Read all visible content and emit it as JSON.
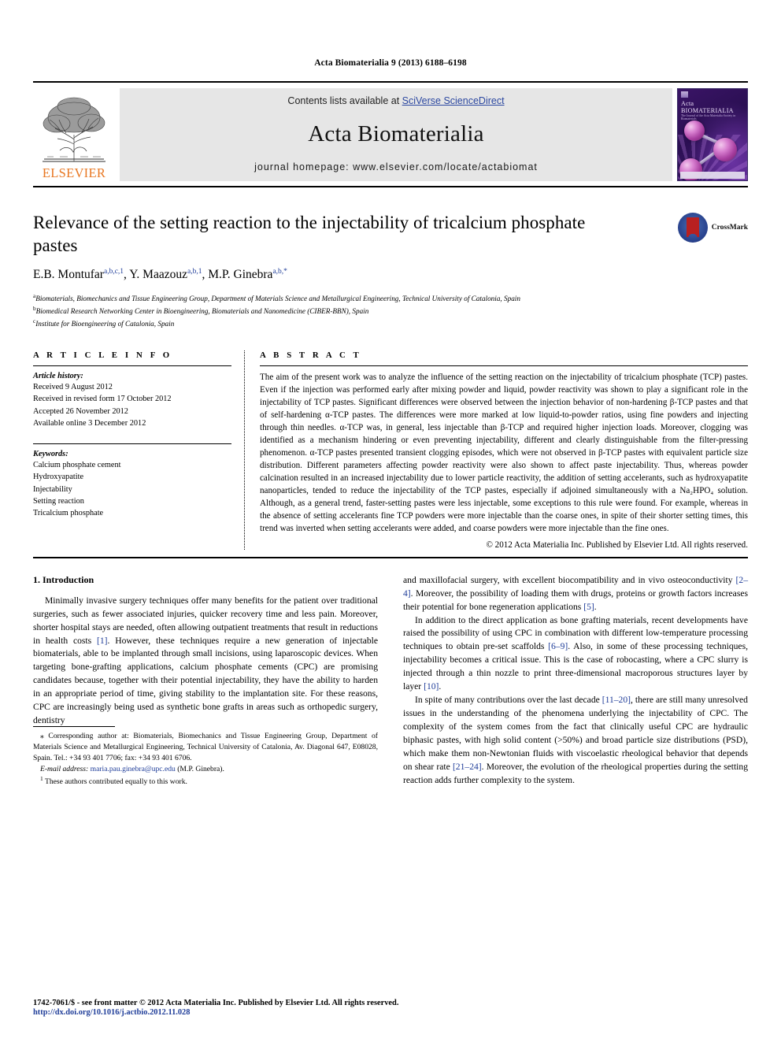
{
  "running_head": "Acta Biomaterialia 9 (2013) 6188–6198",
  "banner": {
    "publisher_logo_name": "ELSEVIER",
    "contents_prefix": "Contents lists available at ",
    "contents_link": "SciVerse ScienceDirect",
    "journal_name": "Acta Biomaterialia",
    "homepage_line": "journal homepage: www.elsevier.com/locate/actabiomat",
    "cover_title": "Acta BIOMATERIALIA",
    "cover_subtitle": "The Journal of the Acta Materialia Society in Biomaterials"
  },
  "article": {
    "title": "Relevance of the setting reaction to the injectability of tricalcium phosphate pastes",
    "crossmark_label": "CrossMark",
    "authors": [
      {
        "name": "E.B. Montufar",
        "sup": "a,b,c,1",
        "sep": ", "
      },
      {
        "name": "Y. Maazouz",
        "sup": "a,b,1",
        "sep": ", "
      },
      {
        "name": "M.P. Ginebra",
        "sup": "a,b,*",
        "sep": ""
      }
    ],
    "affiliations": [
      {
        "mark": "a",
        "text": "Biomaterials, Biomechanics and Tissue Engineering Group, Department of Materials Science and Metallurgical Engineering, Technical University of Catalonia, Spain"
      },
      {
        "mark": "b",
        "text": "Biomedical Research Networking Center in Bioengineering, Biomaterials and Nanomedicine (CIBER-BBN), Spain"
      },
      {
        "mark": "c",
        "text": "Institute for Bioengineering of Catalonia, Spain"
      }
    ]
  },
  "article_info": {
    "heading": "A R T I C L E    I N F O",
    "history_label": "Article history:",
    "history": [
      "Received 9 August 2012",
      "Received in revised form 17 October 2012",
      "Accepted 26 November 2012",
      "Available online 3 December 2012"
    ],
    "keywords_label": "Keywords:",
    "keywords": [
      "Calcium phosphate cement",
      "Hydroxyapatite",
      "Injectability",
      "Setting reaction",
      "Tricalcium phosphate"
    ]
  },
  "abstract": {
    "heading": "A B S T R A C T",
    "text": "The aim of the present work was to analyze the influence of the setting reaction on the injectability of tricalcium phosphate (TCP) pastes. Even if the injection was performed early after mixing powder and liquid, powder reactivity was shown to play a significant role in the injectability of TCP pastes. Significant differences were observed between the injection behavior of non-hardening β-TCP pastes and that of self-hardening α-TCP pastes. The differences were more marked at low liquid-to-powder ratios, using fine powders and injecting through thin needles. α-TCP was, in general, less injectable than β-TCP and required higher injection loads. Moreover, clogging was identified as a mechanism hindering or even preventing injectability, different and clearly distinguishable from the filter-pressing phenomenon. α-TCP pastes presented transient clogging episodes, which were not observed in β-TCP pastes with equivalent particle size distribution. Different parameters affecting powder reactivity were also shown to affect paste injectability. Thus, whereas powder calcination resulted in an increased injectability due to lower particle reactivity, the addition of setting accelerants, such as hydroxyapatite nanoparticles, tended to reduce the injectability of the TCP pastes, especially if adjoined simultaneously with a Na₂HPO₄ solution. Although, as a general trend, faster-setting pastes were less injectable, some exceptions to this rule were found. For example, whereas in the absence of setting accelerants fine TCP powders were more injectable than the coarse ones, in spite of their shorter setting times, this trend was inverted when setting accelerants were added, and coarse powders were more injectable than the fine ones.",
    "copyright": "© 2012 Acta Materialia Inc. Published by Elsevier Ltd. All rights reserved."
  },
  "introduction": {
    "heading": "1. Introduction",
    "left_paragraphs": [
      "Minimally invasive surgery techniques offer many benefits for the patient over traditional surgeries, such as fewer associated injuries, quicker recovery time and less pain. Moreover, shorter hospital stays are needed, often allowing outpatient treatments that result in reductions in health costs [1]. However, these techniques require a new generation of injectable biomaterials, able to be implanted through small incisions, using laparoscopic devices. When targeting bone-grafting applications, calcium phosphate cements (CPC) are promising candidates because, together with their potential injectability, they have the ability to harden in an appropriate period of time, giving stability to the implantation site. For these reasons, CPC are increasingly being used as synthetic bone grafts in areas such as orthopedic surgery, dentistry"
    ],
    "right_paragraphs": [
      "and maxillofacial surgery, with excellent biocompatibility and in vivo osteoconductivity [2–4]. Moreover, the possibility of loading them with drugs, proteins or growth factors increases their potential for bone regeneration applications [5].",
      "In addition to the direct application as bone grafting materials, recent developments have raised the possibility of using CPC in combination with different low-temperature processing techniques to obtain pre-set scaffolds [6–9]. Also, in some of these processing techniques, injectability becomes a critical issue. This is the case of robocasting, where a CPC slurry is injected through a thin nozzle to print three-dimensional macroporous structures layer by layer [10].",
      "In spite of many contributions over the last decade [11–20], there are still many unresolved issues in the understanding of the phenomena underlying the injectability of CPC. The complexity of the system comes from the fact that clinically useful CPC are hydraulic biphasic pastes, with high solid content (>50%) and broad particle size distributions (PSD), which make them non-Newtonian fluids with viscoelastic rheological behavior that depends on shear rate [21–24]. Moreover, the evolution of the rheological properties during the setting reaction adds further complexity to the system."
    ]
  },
  "footnotes": {
    "corresponding": "Corresponding author at: Biomaterials, Biomechanics and Tissue Engineering Group, Department of Materials Science and Metallurgical Engineering, Technical University of Catalonia, Av. Diagonal 647, E08028, Spain. Tel.: +34 93 401 7706; fax: +34 93 401 6706.",
    "email_label": "E-mail address:",
    "email": "maria.pau.ginebra@upc.edu",
    "email_owner": "(M.P. Ginebra).",
    "equal_contrib_mark": "1",
    "equal_contrib": "These authors contributed equally to this work."
  },
  "imprint": {
    "line1": "1742-7061/$ - see front matter © 2012 Acta Materialia Inc. Published by Elsevier Ltd. All rights reserved.",
    "line2": "http://dx.doi.org/10.1016/j.actbio.2012.11.028"
  }
}
